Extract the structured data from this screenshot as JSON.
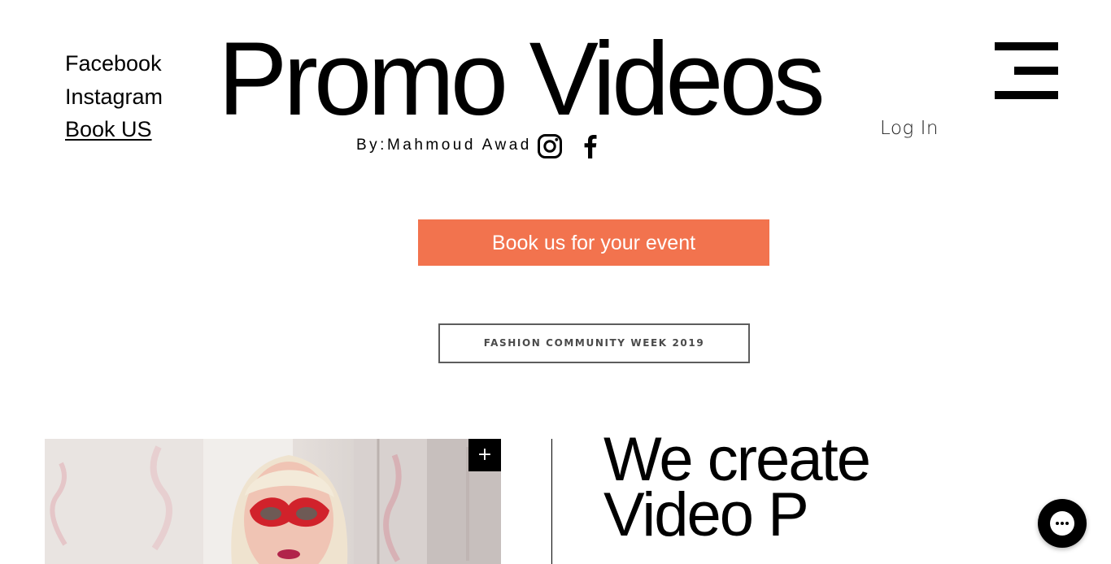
{
  "nav": {
    "links": [
      {
        "label": "Facebook"
      },
      {
        "label": "Instagram"
      },
      {
        "label": "Book US"
      }
    ]
  },
  "header": {
    "title": "Promo Videos",
    "byline": "By:Mahmoud Awad",
    "social": [
      {
        "icon": "instagram-icon"
      },
      {
        "icon": "facebook-icon"
      }
    ],
    "login_label": "Log In",
    "menu_icon": "hamburger-menu-icon"
  },
  "cta": {
    "label": "Book us for your event",
    "color": "#f2734e"
  },
  "event_button": {
    "label": "Fashion Community Week 2019"
  },
  "gallery": {
    "expand_label": "+"
  },
  "headline": {
    "text": "We create Video P"
  },
  "chat": {
    "icon": "chat-bubble-icon"
  }
}
